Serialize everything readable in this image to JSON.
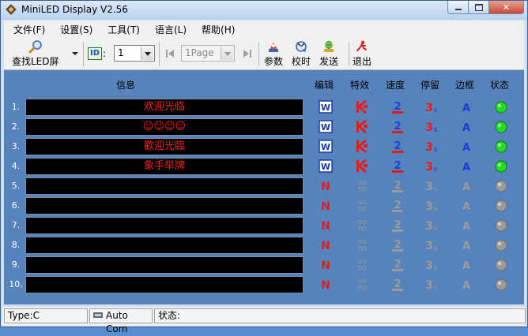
{
  "window": {
    "title": "MiniLED Display V2.56"
  },
  "menu": [
    {
      "id": "file",
      "label": "文件(F)"
    },
    {
      "id": "settings",
      "label": "设置(S)"
    },
    {
      "id": "tools",
      "label": "工具(T)"
    },
    {
      "id": "language",
      "label": "语言(L)"
    },
    {
      "id": "help",
      "label": "帮助(H)"
    }
  ],
  "toolbar": {
    "find_label": "查找LED屏",
    "id_label": "ID",
    "id_colon": ":",
    "id_value": "1",
    "page_value": "1Page",
    "params_label": "参数",
    "sync_label": "校时",
    "send_label": "发送",
    "exit_label": "退出"
  },
  "columns": {
    "info": "信息",
    "edit": "编辑",
    "effect": "特效",
    "speed": "速度",
    "pause": "停留",
    "border": "边框",
    "status": "状态"
  },
  "rows": [
    {
      "num": "1.",
      "text": "欢迎光临",
      "active": true
    },
    {
      "num": "2.",
      "text": "☺☺☺☺",
      "active": true
    },
    {
      "num": "3.",
      "text": "歡迎光臨",
      "active": true
    },
    {
      "num": "4.",
      "text": "象手举牌",
      "active": true
    },
    {
      "num": "5.",
      "text": "",
      "active": false
    },
    {
      "num": "6.",
      "text": "",
      "active": false
    },
    {
      "num": "7.",
      "text": "",
      "active": false
    },
    {
      "num": "8.",
      "text": "",
      "active": false
    },
    {
      "num": "9.",
      "text": "",
      "active": false
    },
    {
      "num": "10.",
      "text": "",
      "active": false
    }
  ],
  "glyphs": {
    "edit_active": "W",
    "edit_new": "N",
    "effect_top": "GO",
    "effect_bottom": "TO",
    "speed": "2",
    "pause_num": "3",
    "pause_unit": "s",
    "border": "A"
  },
  "colors": {
    "active_status": "#22dd22",
    "inactive_status": "#9a9a9a"
  },
  "statusbar": {
    "type": "Type:C",
    "com": "Auto Com",
    "status": "状态:"
  }
}
